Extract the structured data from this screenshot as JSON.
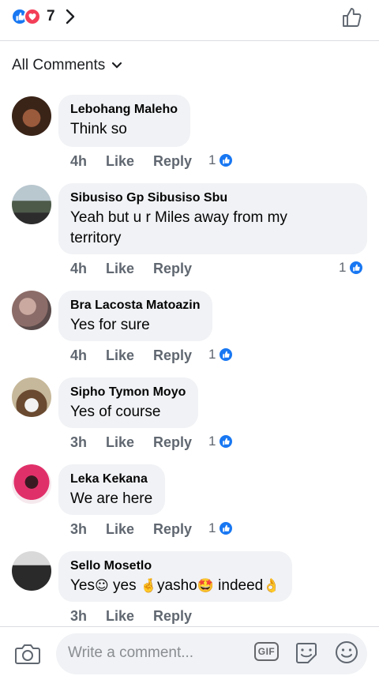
{
  "header": {
    "reaction_count": "7",
    "reaction_icons": [
      "like-icon",
      "love-icon"
    ],
    "colors": {
      "like": "#1877f2",
      "love": "#f33e58"
    }
  },
  "filter": {
    "label": "All Comments"
  },
  "comments": [
    {
      "name": "Lebohang Maleho",
      "text": "Think so",
      "time": "4h",
      "like": "Like",
      "reply": "Reply",
      "likes": "1"
    },
    {
      "name": "Sibusiso Gp Sibusiso Sbu",
      "text_line1": "Yeah but u r Miles away from my",
      "text_line2": "territory",
      "time": "4h",
      "like": "Like",
      "reply": "Reply",
      "likes": "1"
    },
    {
      "name": "Bra Lacosta Matoazin",
      "text": "Yes for sure",
      "time": "4h",
      "like": "Like",
      "reply": "Reply",
      "likes": "1"
    },
    {
      "name": "Sipho Tymon Moyo",
      "text": "Yes of course",
      "time": "3h",
      "like": "Like",
      "reply": "Reply",
      "likes": "1"
    },
    {
      "name": "Leka Kekana",
      "text": "We are here",
      "time": "3h",
      "like": "Like",
      "reply": "Reply",
      "likes": "1"
    },
    {
      "name": "Sello Mosetlo",
      "text_parts": [
        "Yes",
        "☺",
        " yes ",
        "🤞",
        "yasho",
        "🤩",
        " indeed",
        "👌"
      ],
      "time": "3h",
      "like": "Like",
      "reply": "Reply"
    }
  ],
  "composer": {
    "placeholder": "Write a comment...",
    "gif_label": "GIF"
  }
}
